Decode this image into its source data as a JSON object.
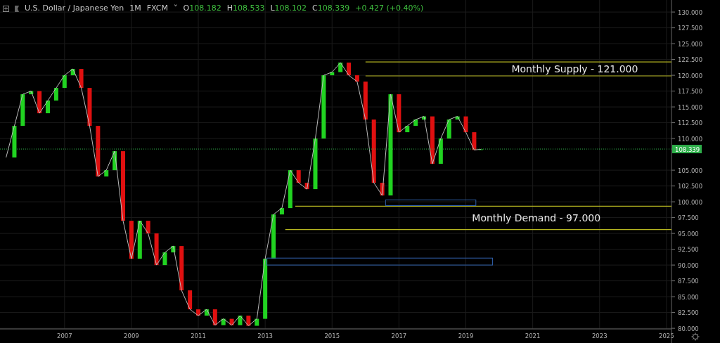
{
  "header": {
    "symbol": "U.S. Dollar / Japanese Yen",
    "interval": "1M",
    "source": "FXCM",
    "caret": "˅",
    "ohlc": [
      {
        "key": "O",
        "value": "108.182"
      },
      {
        "key": "H",
        "value": "108.533"
      },
      {
        "key": "L",
        "value": "108.102"
      },
      {
        "key": "C",
        "value": "108.339"
      }
    ],
    "change": "+0.427 (+0.40%)"
  },
  "chart": {
    "chart_data": {
      "type": "line",
      "grid": true,
      "xlim": [
        2005.07,
        2025.15
      ],
      "ylim": [
        79.9,
        131.9
      ],
      "xticks": [
        {
          "value": 2007,
          "label": "2007"
        },
        {
          "value": 2009,
          "label": "2009"
        },
        {
          "value": 2011,
          "label": "2011"
        },
        {
          "value": 2013,
          "label": "2013"
        },
        {
          "value": 2015,
          "label": "2015"
        },
        {
          "value": 2017,
          "label": "2017"
        },
        {
          "value": 2019,
          "label": "2019"
        },
        {
          "value": 2021,
          "label": "2021"
        },
        {
          "value": 2023,
          "label": "2023"
        },
        {
          "value": 2025,
          "label": "2025"
        }
      ],
      "yticks": [
        {
          "value": 80,
          "label": "80.000"
        },
        {
          "value": 82.5,
          "label": "82.500"
        },
        {
          "value": 85,
          "label": "85.000"
        },
        {
          "value": 87.5,
          "label": "87.500"
        },
        {
          "value": 90,
          "label": "90.000"
        },
        {
          "value": 92.5,
          "label": "92.500"
        },
        {
          "value": 95,
          "label": "95.000"
        },
        {
          "value": 97.5,
          "label": "97.500"
        },
        {
          "value": 100,
          "label": "100.000"
        },
        {
          "value": 102.5,
          "label": "102.500"
        },
        {
          "value": 105,
          "label": "105.000"
        },
        {
          "value": 110,
          "label": "110.000"
        },
        {
          "value": 112.5,
          "label": "112.500"
        },
        {
          "value": 115,
          "label": "115.000"
        },
        {
          "value": 117.5,
          "label": "117.500"
        },
        {
          "value": 120,
          "label": "120.000"
        },
        {
          "value": 122.5,
          "label": "122.500"
        },
        {
          "value": 125,
          "label": "125.000"
        },
        {
          "value": 127.5,
          "label": "127.500"
        },
        {
          "value": 130,
          "label": "130.000"
        }
      ],
      "x": [
        2005.25,
        2005.5,
        2005.75,
        2006,
        2006.25,
        2006.5,
        2006.75,
        2007,
        2007.25,
        2007.5,
        2007.75,
        2008,
        2008.25,
        2008.5,
        2008.75,
        2009,
        2009.25,
        2009.5,
        2009.75,
        2010,
        2010.25,
        2010.5,
        2010.75,
        2011,
        2011.25,
        2011.5,
        2011.75,
        2012,
        2012.25,
        2012.5,
        2012.75,
        2013,
        2013.25,
        2013.5,
        2013.75,
        2014,
        2014.25,
        2014.5,
        2014.75,
        2015,
        2015.25,
        2015.5,
        2015.75,
        2016,
        2016.25,
        2016.5,
        2016.75,
        2017,
        2017.25,
        2017.5,
        2017.75,
        2018,
        2018.25,
        2018.5,
        2018.75,
        2019,
        2019.25,
        2019.45
      ],
      "ref_lines": [
        {
          "axis": "y",
          "value": 122.1,
          "color": "#b5b520"
        },
        {
          "axis": "y",
          "value": 119.9,
          "color": "#b5b520"
        },
        {
          "axis": "y",
          "value": 99.3,
          "color": "#b5b520"
        },
        {
          "axis": "y",
          "value": 95.6,
          "color": "#b5b520"
        },
        {
          "axis": "y",
          "value": 108.339,
          "color": "#2eae4a",
          "label": "108.339"
        }
      ],
      "series": [
        {
          "color": "#bbbbbb",
          "values": [
            107,
            112,
            117,
            117.5,
            114,
            116,
            118,
            120,
            121,
            118,
            112,
            104,
            105,
            108,
            97,
            91,
            97,
            95,
            90,
            92,
            93,
            86,
            83,
            82,
            83,
            80.5,
            81.5,
            80.5,
            82,
            80.4,
            81.5,
            91,
            98,
            99,
            105,
            103,
            102,
            110,
            120,
            120.5,
            122,
            120,
            119,
            113,
            103,
            101,
            117,
            111,
            112,
            113,
            113.5,
            106,
            110,
            113,
            113.5,
            111,
            108.2,
            108.3
          ]
        }
      ]
    },
    "drawings": [
      {
        "kind": "zone",
        "label": "Monthly Supply - 121.000"
      },
      {
        "kind": "zone",
        "label": "Monthly Demand - 97.000"
      },
      {
        "kind": "box"
      },
      {
        "kind": "box"
      }
    ]
  }
}
